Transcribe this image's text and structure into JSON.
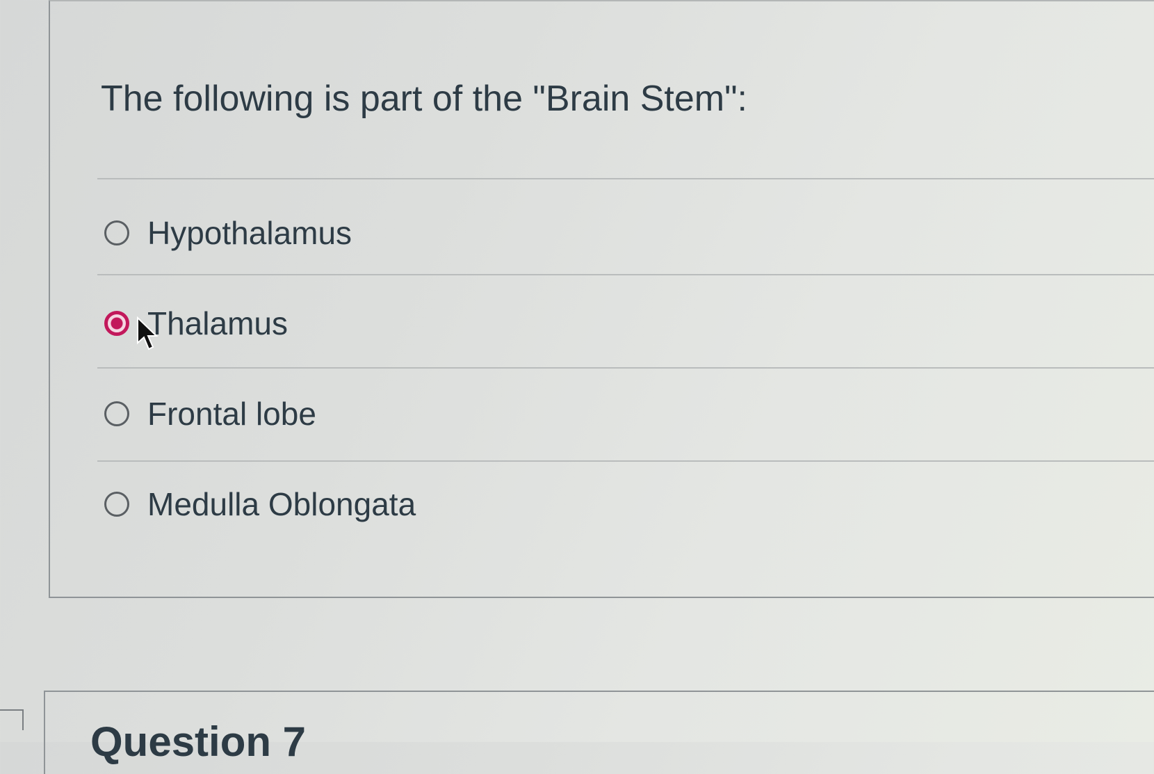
{
  "question": {
    "text": "The following is part of the \"Brain Stem\":",
    "answers": [
      {
        "label": "Hypothalamus",
        "selected": false
      },
      {
        "label": "Thalamus",
        "selected": true
      },
      {
        "label": "Frontal lobe",
        "selected": false
      },
      {
        "label": "Medulla Oblongata",
        "selected": false
      }
    ]
  },
  "next_question": {
    "title": "Question 7"
  },
  "colors": {
    "selected_radio": "#c2185b",
    "text": "#2d3b45"
  }
}
